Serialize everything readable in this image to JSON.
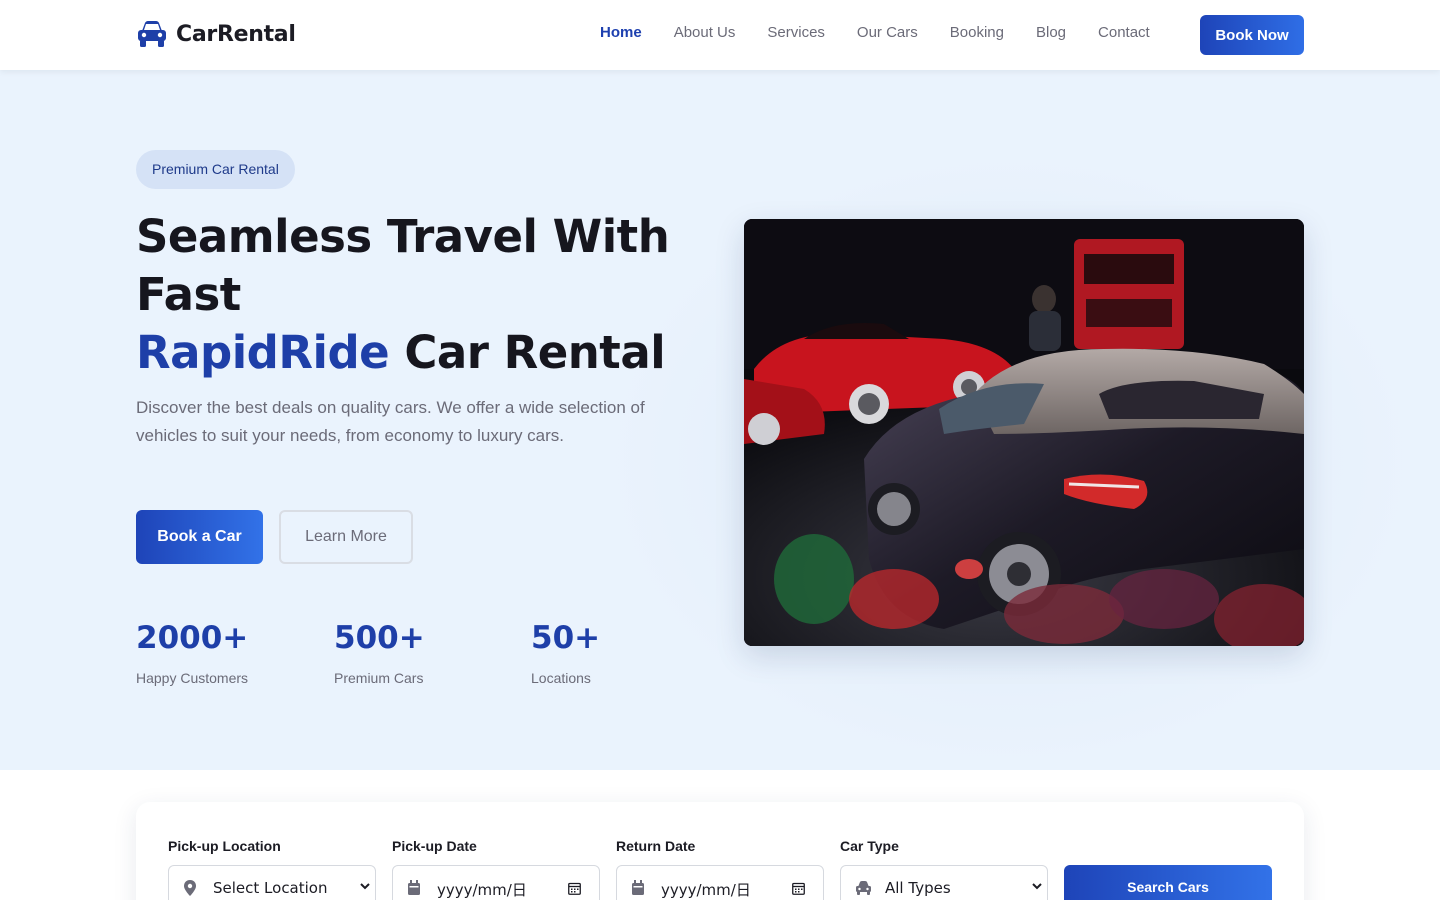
{
  "brand": {
    "name": "CarRental"
  },
  "nav": {
    "links": [
      "Home",
      "About Us",
      "Services",
      "Our Cars",
      "Booking",
      "Blog",
      "Contact"
    ],
    "active": "Home",
    "book_label": "Book Now"
  },
  "hero": {
    "badge": "Premium Car Rental",
    "title_line1": "Seamless Travel With",
    "title_line2": "Fast",
    "title_accent": "RapidRide",
    "title_line3_rest": " Car Rental",
    "description": "Discover the best deals on quality cars. We offer a wide selection of vehicles to suit your needs, from economy to luxury cars.",
    "primary_button": "Book a Car",
    "secondary_button": "Learn More",
    "stats": [
      {
        "value": "2000+",
        "label": "Happy Customers"
      },
      {
        "value": "500+",
        "label": "Premium Cars"
      },
      {
        "value": "50+",
        "label": "Locations"
      }
    ]
  },
  "search": {
    "pickup_location": {
      "label": "Pick-up Location",
      "value": "Select Location"
    },
    "pickup_date": {
      "label": "Pick-up Date",
      "value": "yyyy/mm/日"
    },
    "return_date": {
      "label": "Return Date",
      "value": "yyyy/mm/日"
    },
    "car_type": {
      "label": "Car Type",
      "value": "All Types"
    },
    "button": "Search Cars"
  },
  "colors": {
    "accent": "#1e3fa8",
    "button_gradient_start": "#1e44b8",
    "button_gradient_end": "#3272e8",
    "hero_bg": "#eaf3fd"
  }
}
